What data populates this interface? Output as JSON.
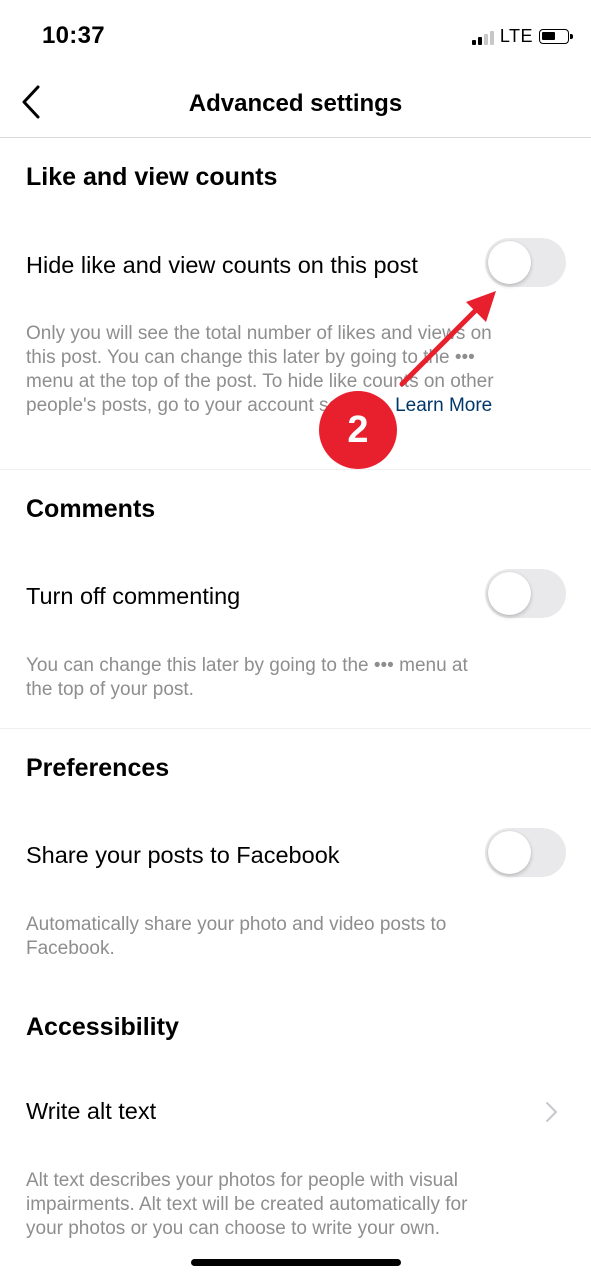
{
  "status_bar": {
    "time": "10:37",
    "network": "LTE"
  },
  "header": {
    "title": "Advanced settings"
  },
  "sections": {
    "like_view": {
      "title": "Like and view counts",
      "row_label": "Hide like and view counts on this post",
      "toggle_on": false,
      "desc_line1": "Only you will see the total number of likes and views on",
      "desc_line2": "this post. You can change this later by going to the •••",
      "desc_line3": "menu at the top of the post. To hide like counts on other",
      "desc_line4": "people's posts, go to your account settings.",
      "learn_more": "Learn More"
    },
    "comments": {
      "title": "Comments",
      "row_label": "Turn off commenting",
      "toggle_on": false,
      "desc_line1": "You can change this later by going to the ••• menu at",
      "desc_line2": "the top of your post."
    },
    "preferences": {
      "title": "Preferences",
      "row_label": "Share your posts to Facebook",
      "toggle_on": false,
      "desc_line1": "Automatically share your photo and video posts to",
      "desc_line2": "Facebook."
    },
    "accessibility": {
      "title": "Accessibility",
      "row_label": "Write alt text",
      "desc_line1": "Alt text describes your photos for people with visual",
      "desc_line2": "impairments. Alt text will be created automatically for",
      "desc_line3": "your photos or you can choose to write your own."
    }
  },
  "annotation": {
    "step_number": "2",
    "color": "#e8202e"
  },
  "colors": {
    "link": "#00376b",
    "secondary_text": "#8e8e8e",
    "toggle_off": "#e9e9eb"
  }
}
